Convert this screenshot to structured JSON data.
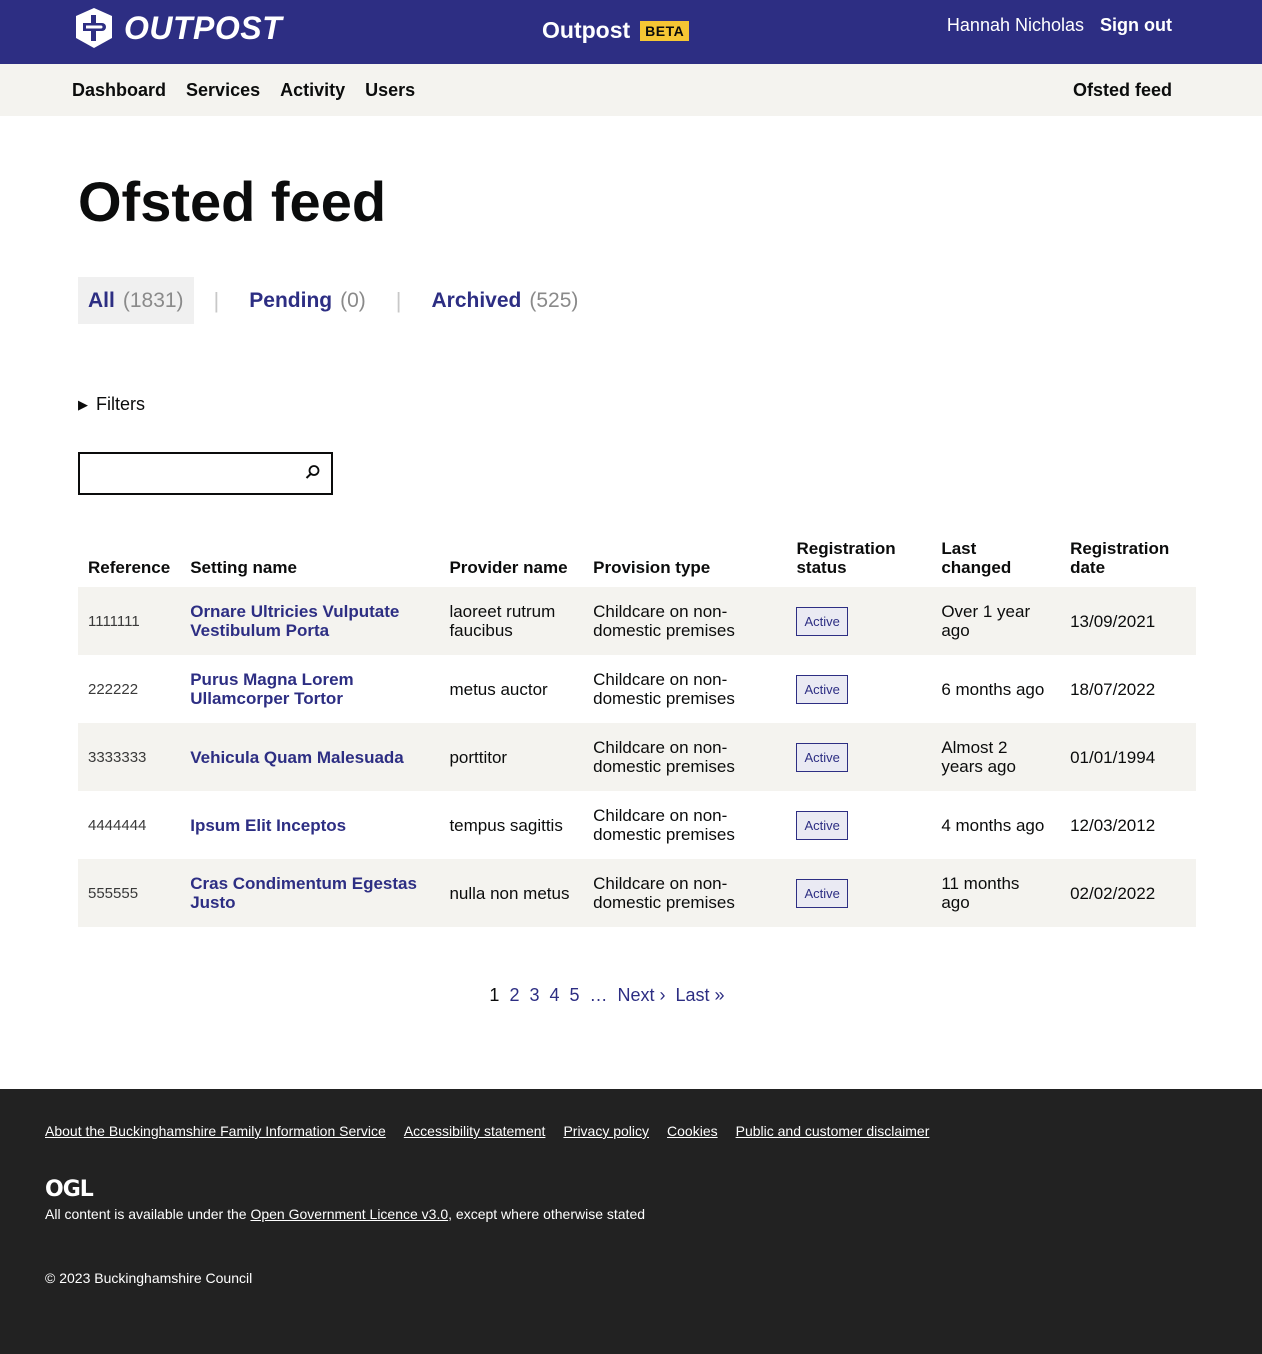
{
  "header": {
    "logo_text": "OUTPOST",
    "service_name": "Outpost",
    "beta_tag": "BETA",
    "user_name": "Hannah Nicholas",
    "signout_label": "Sign out"
  },
  "nav": {
    "items": [
      {
        "label": "Dashboard"
      },
      {
        "label": "Services"
      },
      {
        "label": "Activity"
      },
      {
        "label": "Users"
      }
    ],
    "right_label": "Ofsted feed"
  },
  "page": {
    "title": "Ofsted feed"
  },
  "tabs": [
    {
      "label": "All",
      "count": "(1831)"
    },
    {
      "label": "Pending",
      "count": "(0)"
    },
    {
      "label": "Archived",
      "count": "(525)"
    }
  ],
  "tab_separator": "|",
  "filters": {
    "label": "Filters"
  },
  "search": {
    "value": "",
    "placeholder": ""
  },
  "table": {
    "headers": [
      "Reference",
      "Setting name",
      "Provider name",
      "Provision type",
      "Registration status",
      "Last changed",
      "Registration date"
    ],
    "rows": [
      {
        "reference": "1111111",
        "setting": "Ornare Ultricies Vulputate Vestibulum Porta",
        "provider": "laoreet rutrum faucibus",
        "provision": "Childcare on non-domestic premises",
        "status": "Active",
        "changed": "Over 1 year ago",
        "date": "13/09/2021"
      },
      {
        "reference": "222222",
        "setting": "Purus Magna Lorem Ullamcorper Tortor",
        "provider": "metus auctor",
        "provision": "Childcare on non-domestic premises",
        "status": "Active",
        "changed": "6 months ago",
        "date": "18/07/2022"
      },
      {
        "reference": "3333333",
        "setting": "Vehicula Quam Malesuada",
        "provider": "porttitor",
        "provision": "Childcare on non-domestic premises",
        "status": "Active",
        "changed": "Almost 2 years ago",
        "date": "01/01/1994"
      },
      {
        "reference": "4444444",
        "setting": "Ipsum Elit Inceptos",
        "provider": "tempus sagittis",
        "provision": "Childcare on non-domestic premises",
        "status": "Active",
        "changed": "4 months ago",
        "date": "12/03/2012"
      },
      {
        "reference": "555555",
        "setting": "Cras Condimentum Egestas Justo",
        "provider": "nulla non metus",
        "provision": "Childcare on non-domestic premises",
        "status": "Active",
        "changed": "11 months ago",
        "date": "02/02/2022"
      }
    ]
  },
  "pagination": {
    "current": "1",
    "pages": [
      "2",
      "3",
      "4",
      "5"
    ],
    "ellipsis": "…",
    "next": "Next ›",
    "last": "Last »"
  },
  "footer": {
    "links": [
      {
        "label": "About the Buckinghamshire Family Information Service"
      },
      {
        "label": "Accessibility statement"
      },
      {
        "label": "Privacy policy"
      },
      {
        "label": "Cookies"
      },
      {
        "label": "Public and customer disclaimer"
      }
    ],
    "ogl_logo": "OGL",
    "licence_prefix": "All content is available under the ",
    "licence_link": "Open Government Licence v3.0",
    "licence_suffix": ", except where otherwise stated",
    "copyright": "© 2023 Buckinghamshire Council"
  },
  "colors": {
    "brand": "#2d2e83",
    "beta": "#f5c634",
    "footer_bg": "#222222",
    "row_alt": "#f4f3ef"
  }
}
